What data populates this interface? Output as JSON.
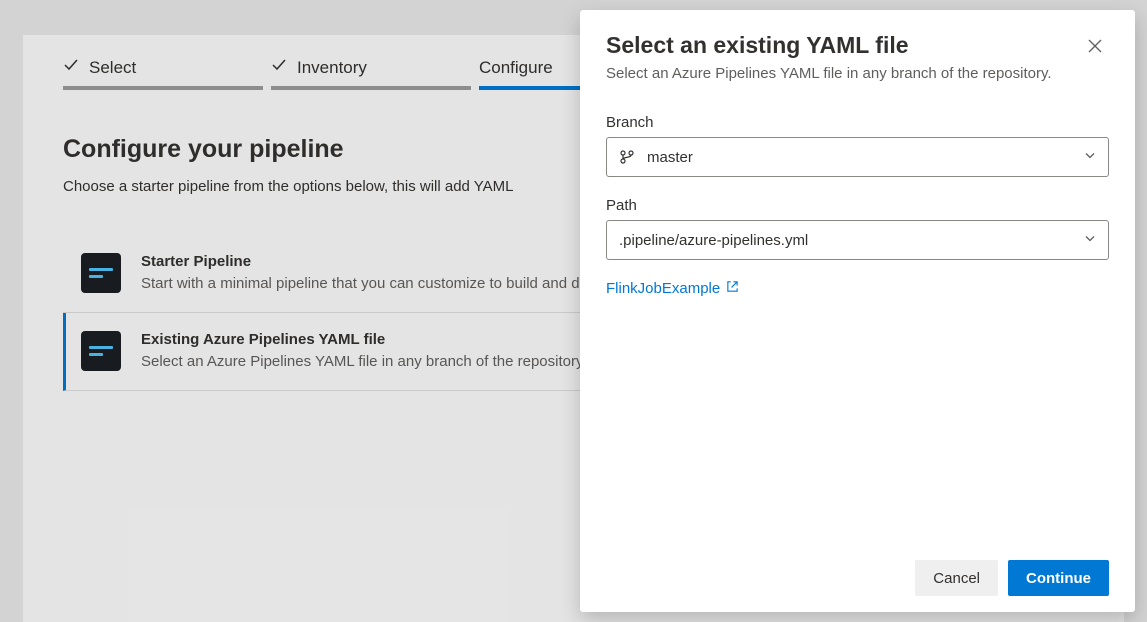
{
  "wizard": {
    "steps": [
      {
        "label": "Select",
        "state": "completed"
      },
      {
        "label": "Inventory",
        "state": "completed"
      },
      {
        "label": "Configure",
        "state": "active"
      }
    ]
  },
  "page": {
    "title": "Configure your pipeline",
    "subtitle": "Choose a starter pipeline from the options below, this will add YAML"
  },
  "options": [
    {
      "title": "Starter Pipeline",
      "desc": "Start with a minimal pipeline that you can customize to build and deploy your code."
    },
    {
      "title": "Existing Azure Pipelines YAML file",
      "desc": "Select an Azure Pipelines YAML file in any branch of the repository."
    }
  ],
  "modal": {
    "title": "Select an existing YAML file",
    "subtitle": "Select an Azure Pipelines YAML file in any branch of the repository.",
    "branch": {
      "label": "Branch",
      "value": "master"
    },
    "path": {
      "label": "Path",
      "value": ".pipeline/azure-pipelines.yml"
    },
    "link_text": "FlinkJobExample",
    "cancel_label": "Cancel",
    "continue_label": "Continue"
  }
}
